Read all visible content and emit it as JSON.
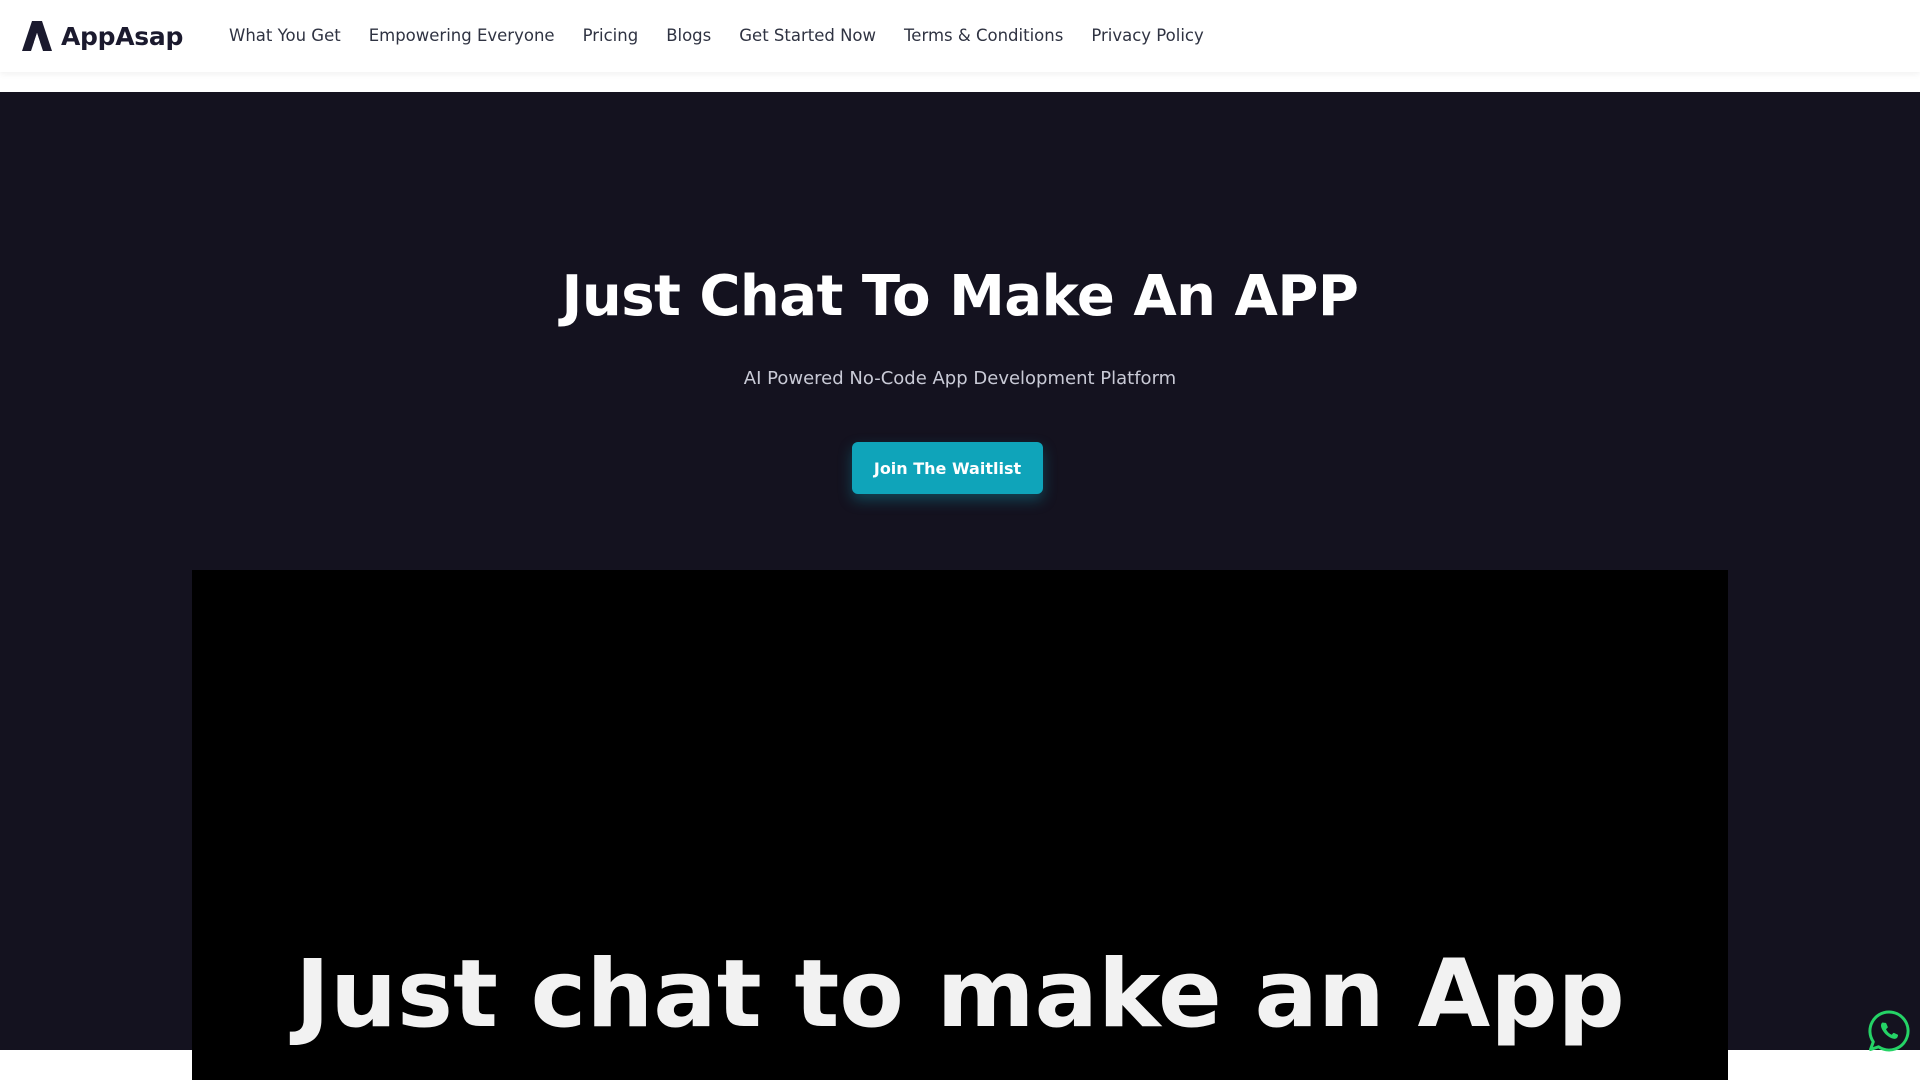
{
  "brand": {
    "name": "AppAsap",
    "logo_icon": "appasap-logo-icon"
  },
  "nav": {
    "items": [
      "What You Get",
      "Empowering Everyone",
      "Pricing",
      "Blogs",
      "Get Started Now",
      "Terms & Conditions",
      "Privacy Policy"
    ]
  },
  "hero": {
    "title": "Just Chat To Make An APP",
    "subtitle": "AI Powered No-Code App Development Platform",
    "cta_label": "Join The Waitlist"
  },
  "video": {
    "caption": "Just chat to make an App"
  },
  "floating": {
    "whatsapp_icon": "whatsapp-icon"
  },
  "colors": {
    "hero_background": "#14121f",
    "accent": "#0fa4ba",
    "whatsapp_green": "#25d366"
  }
}
